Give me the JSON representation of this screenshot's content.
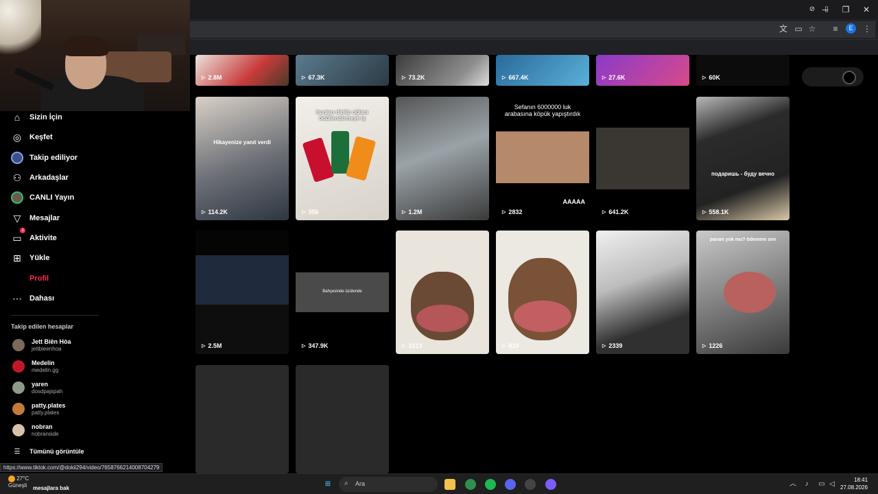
{
  "window": {
    "minimize": "─",
    "maximize": "❐",
    "close": "✕"
  },
  "browser": {
    "profile_initial": "E"
  },
  "sidebar": {
    "items": [
      {
        "label": "Sizin İçin",
        "icon": "home-icon",
        "glyph": "⌂"
      },
      {
        "label": "Keşfet",
        "icon": "compass-icon",
        "glyph": "◎"
      },
      {
        "label": "Takip ediliyor",
        "icon": "following-avatar-icon",
        "glyph": ""
      },
      {
        "label": "Arkadaşlar",
        "icon": "friends-icon",
        "glyph": "⚇"
      },
      {
        "label": "CANLI Yayın",
        "icon": "live-avatar-icon",
        "glyph": ""
      },
      {
        "label": "Mesajlar",
        "icon": "paper-plane-icon",
        "glyph": "▽"
      },
      {
        "label": "Aktivite",
        "icon": "activity-icon",
        "glyph": "▭",
        "badge": "1"
      },
      {
        "label": "Yükle",
        "icon": "upload-plus-icon",
        "glyph": "⊞"
      },
      {
        "label": "Profil",
        "icon": "",
        "glyph": ""
      },
      {
        "label": "Dahası",
        "icon": "more-dots-icon",
        "glyph": "⋯"
      }
    ],
    "followed_heading": "Takip edilen hesaplar",
    "accounts": [
      {
        "name": "Jett Biên Hòa",
        "username": "jettbieenhoa",
        "color": "#7a6a5a"
      },
      {
        "name": "Medelin",
        "username": "medelin.gg",
        "color": "#c0182a"
      },
      {
        "name": "yaren",
        "username": "dosdpajspah",
        "color": "#8d9a8a"
      },
      {
        "name": "patty.plates",
        "username": "patty.plates",
        "color": "#c47a3a"
      },
      {
        "name": "nobran",
        "username": "nobranside",
        "color": "#d6c2a8"
      }
    ],
    "see_all": "Tümünü görüntüle"
  },
  "videos": {
    "row1": [
      "2.8M",
      "67.3K",
      "73.2K",
      "667.4K",
      "27.6K",
      "60K"
    ],
    "row2": [
      {
        "views": "114.2K",
        "caption": "Hikayenize yanıt verdi"
      },
      {
        "views": "356",
        "caption": "bunları dinlip oğlanı ödüllendirmeye iş"
      },
      {
        "views": "1.2M",
        "caption": ""
      },
      {
        "views": "2832",
        "caption": "Sefanın 6000000 luk arabasına köpük yapıştırdık",
        "tag": "AAAAA"
      },
      {
        "views": "641.2K",
        "caption": ""
      },
      {
        "views": "558.1K",
        "caption": "подаришь - буду вечно"
      }
    ],
    "row3": [
      {
        "views": "2.5M",
        "caption": ""
      },
      {
        "views": "347.9K",
        "caption": "Bahçesinde üzülende"
      },
      {
        "views": "1513",
        "caption": ""
      },
      {
        "views": "810",
        "caption": ""
      },
      {
        "views": "2339",
        "caption": ""
      },
      {
        "views": "1226",
        "caption": "param yok mu? ödemem sen"
      }
    ]
  },
  "status_url": "https://www.tiktok.com/@dokii294/video/7658766214008704279",
  "taskbar": {
    "weather": "27°C",
    "weather_desc": "Güneşli",
    "search_placeholder": "Ara",
    "overlay_text": "mesajlara bak",
    "time": "18:41",
    "date": "27.08.2026"
  }
}
